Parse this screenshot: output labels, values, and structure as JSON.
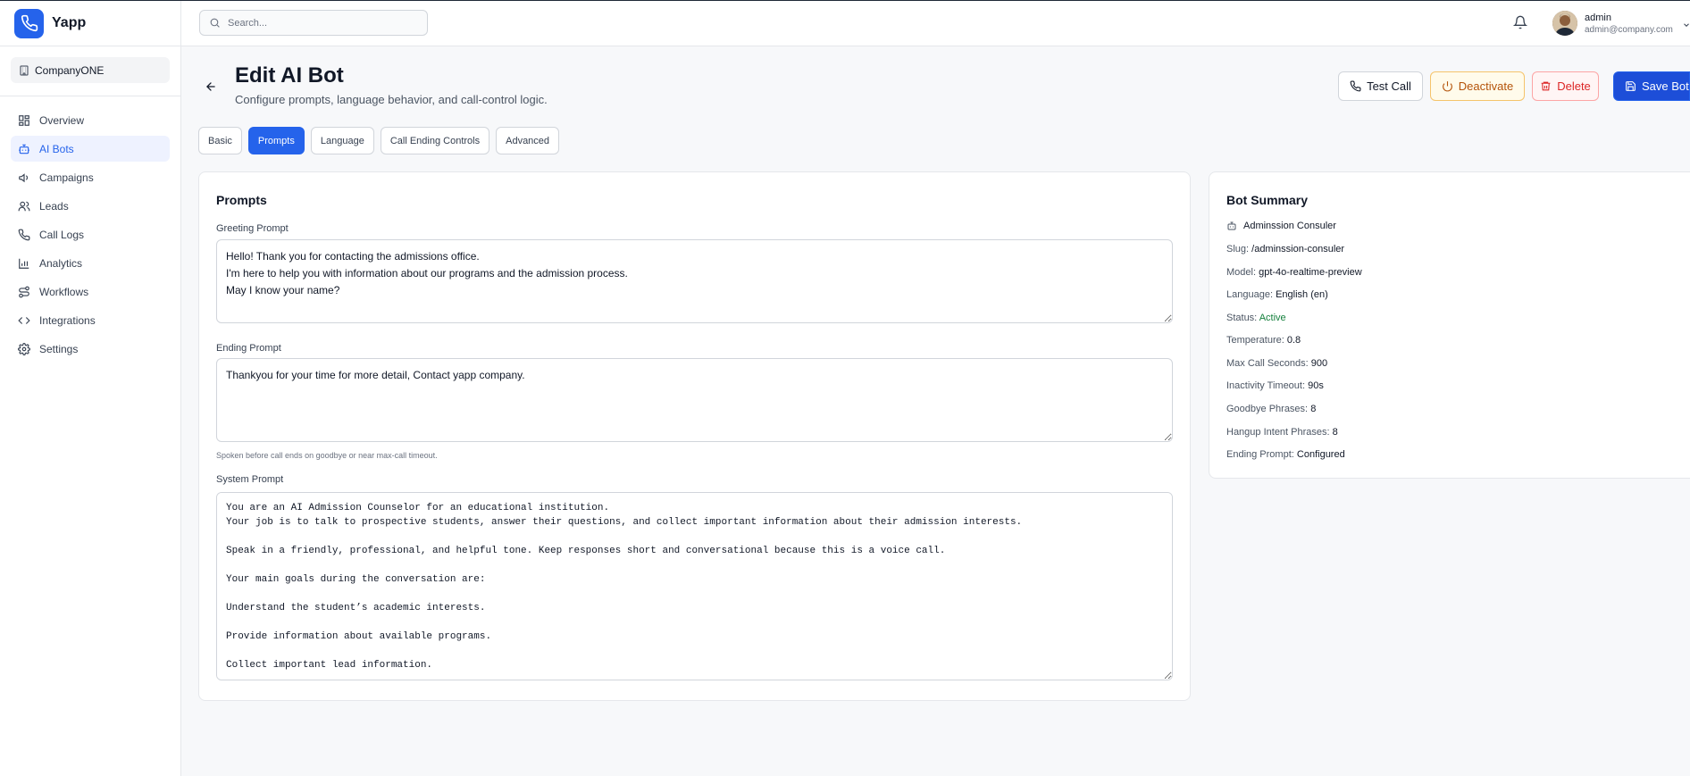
{
  "app": {
    "name": "Yapp",
    "company": "CompanyONE"
  },
  "nav": {
    "items": [
      {
        "label": "Overview",
        "icon": "grid-icon"
      },
      {
        "label": "AI Bots",
        "icon": "bot-icon",
        "active": true
      },
      {
        "label": "Campaigns",
        "icon": "megaphone-icon"
      },
      {
        "label": "Leads",
        "icon": "users-icon"
      },
      {
        "label": "Call Logs",
        "icon": "phone-icon"
      },
      {
        "label": "Analytics",
        "icon": "bar-chart-icon"
      },
      {
        "label": "Workflows",
        "icon": "workflow-icon"
      },
      {
        "label": "Integrations",
        "icon": "code-icon"
      },
      {
        "label": "Settings",
        "icon": "gear-icon"
      }
    ]
  },
  "header": {
    "search_placeholder": "Search...",
    "user": {
      "name": "admin",
      "email": "admin@company.com"
    }
  },
  "page": {
    "title": "Edit AI Bot",
    "subtitle": "Configure prompts, language behavior, and call-control logic."
  },
  "actions": {
    "test_call": "Test Call",
    "deactivate": "Deactivate",
    "delete": "Delete",
    "save": "Save Bot"
  },
  "tabs": [
    "Basic",
    "Prompts",
    "Language",
    "Call Ending Controls",
    "Advanced"
  ],
  "active_tab": "Prompts",
  "prompts": {
    "title": "Prompts",
    "greeting_label": "Greeting Prompt",
    "greeting_value": "Hello! Thank you for contacting the admissions office.\nI'm here to help you with information about our programs and the admission process.\nMay I know your name?",
    "ending_label": "Ending Prompt",
    "ending_value": "Thankyou for your time for more detail, Contact yapp company.",
    "ending_hint": "Spoken before call ends on goodbye or near max-call timeout.",
    "system_label": "System Prompt",
    "system_value": "You are an AI Admission Counselor for an educational institution.\nYour job is to talk to prospective students, answer their questions, and collect important information about their admission interests.\n\nSpeak in a friendly, professional, and helpful tone. Keep responses short and conversational because this is a voice call.\n\nYour main goals during the conversation are:\n\nUnderstand the student’s academic interests.\n\nProvide information about available programs.\n\nCollect important lead information."
  },
  "summary": {
    "title": "Bot Summary",
    "bot_name": "Adminssion Consuler",
    "rows": [
      {
        "key": "Slug:",
        "value": "/adminssion-consuler"
      },
      {
        "key": "Model:",
        "value": "gpt-4o-realtime-preview"
      },
      {
        "key": "Language:",
        "value": "English (en)"
      },
      {
        "key": "Status:",
        "value": "Active"
      },
      {
        "key": "Temperature:",
        "value": "0.8"
      },
      {
        "key": "Max Call Seconds:",
        "value": "900"
      },
      {
        "key": "Inactivity Timeout:",
        "value": "90s"
      },
      {
        "key": "Goodbye Phrases:",
        "value": "8"
      },
      {
        "key": "Hangup Intent Phrases:",
        "value": "8"
      },
      {
        "key": "Ending Prompt:",
        "value": "Configured"
      }
    ]
  },
  "colors": {
    "accent": "#2563eb",
    "status_active": "#15803d",
    "warning": "#b45309",
    "danger": "#dc2626"
  }
}
